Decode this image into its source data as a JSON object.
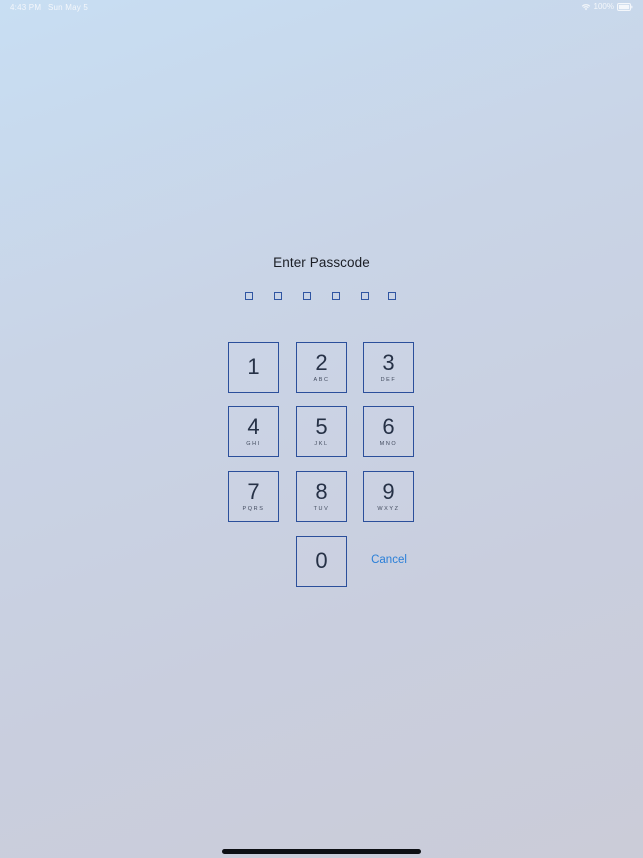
{
  "status_bar": {
    "time": "4:43 PM",
    "date": "Sun May 5",
    "battery": "100%",
    "wifi_icon": "wifi-icon",
    "battery_icon": "battery-icon"
  },
  "passcode": {
    "title": "Enter Passcode",
    "entered_digits": 0,
    "total_digits": 6
  },
  "keypad": {
    "keys": [
      {
        "digit": "1",
        "letters": ""
      },
      {
        "digit": "2",
        "letters": "ABC"
      },
      {
        "digit": "3",
        "letters": "DEF"
      },
      {
        "digit": "4",
        "letters": "GHI"
      },
      {
        "digit": "5",
        "letters": "JKL"
      },
      {
        "digit": "6",
        "letters": "MNO"
      },
      {
        "digit": "7",
        "letters": "PQRS"
      },
      {
        "digit": "8",
        "letters": "TUV"
      },
      {
        "digit": "9",
        "letters": "WXYZ"
      },
      {
        "digit": "0",
        "letters": ""
      }
    ],
    "cancel_label": "Cancel"
  },
  "colors": {
    "key_border": "#2b4f9b",
    "cancel_link": "#2a7fd8",
    "title_text": "#1a1d24"
  }
}
